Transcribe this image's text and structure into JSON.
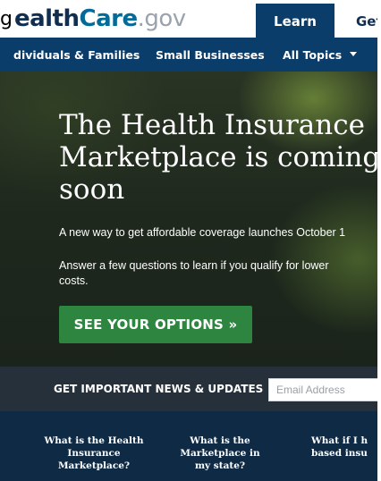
{
  "header": {
    "stray_char": "g",
    "logo": {
      "part1": "ealth",
      "part2": "Care",
      "part3": ".gov"
    },
    "tabs": [
      {
        "label": "Learn",
        "active": true
      },
      {
        "label": "Get"
      }
    ]
  },
  "nav": {
    "items": [
      {
        "label": "dividuals & Families"
      },
      {
        "label": "Small Businesses"
      },
      {
        "label": "All Topics",
        "icon": "chevron-down-icon"
      }
    ]
  },
  "hero": {
    "title": "The Health Insurance Marketplace is coming soon",
    "subtitle": "A new way to get affordable coverage launches October 1",
    "body": "Answer a few questions to learn if you qualify for lower costs.",
    "cta_label": "SEE YOUR OPTIONS »"
  },
  "newsletter": {
    "label": "GET IMPORTANT NEWS & UPDATES",
    "email_placeholder": "Email Address"
  },
  "faq": {
    "items": [
      {
        "question": "What is the Health Insurance Marketplace?"
      },
      {
        "question": "What is the Marketplace in my state?"
      },
      {
        "question": "What if I h based insu"
      }
    ]
  },
  "colors": {
    "brand_navy": "#0b3d6b",
    "cta_green": "#2e8540",
    "logo_dark": "#112e51",
    "logo_blue": "#046b99",
    "news_bar": "#26303a",
    "faq_bar": "#0e2a44"
  }
}
